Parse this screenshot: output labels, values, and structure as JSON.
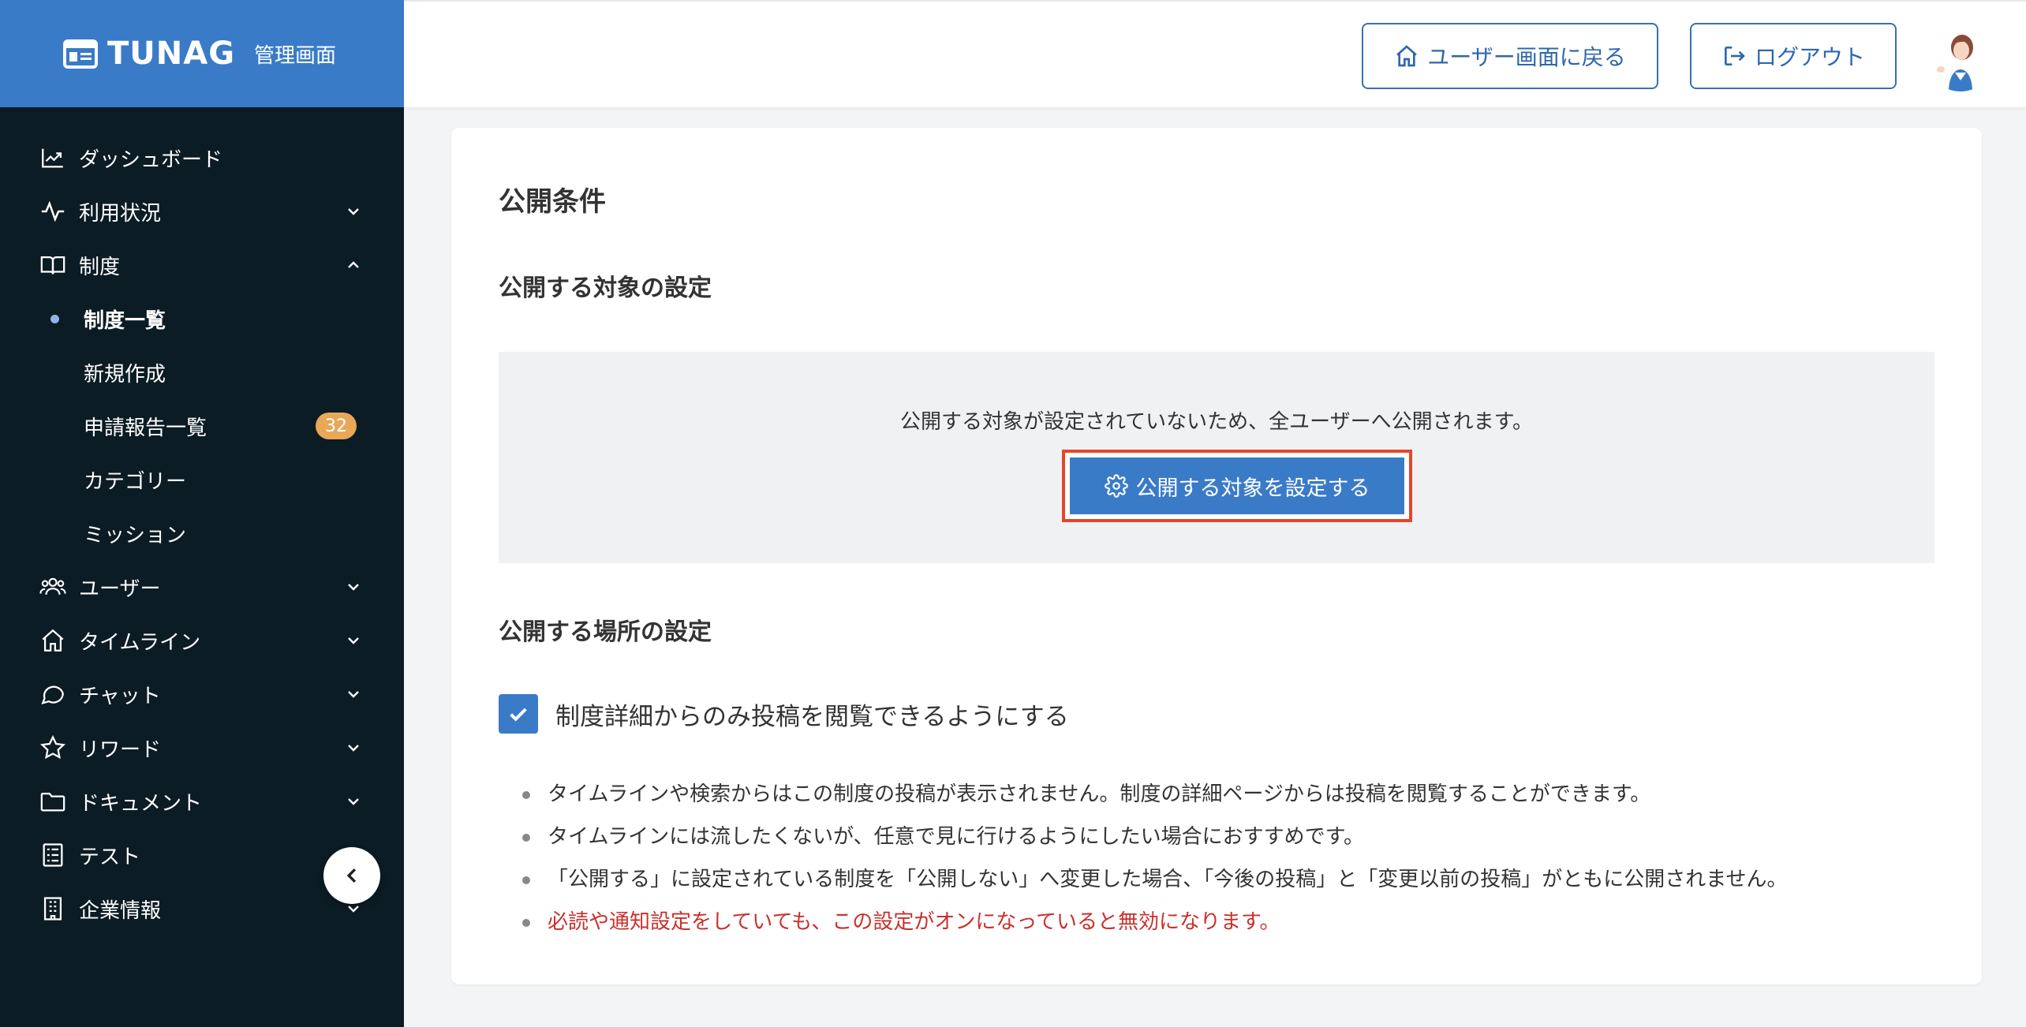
{
  "brand": {
    "name": "TUNAG",
    "sub": "管理画面",
    "color": "#3a7bc8"
  },
  "sidebar": {
    "items": [
      {
        "label": "ダッシュボード",
        "icon": "chart-line-icon"
      },
      {
        "label": "利用状況",
        "icon": "activity-icon",
        "chevron": "down"
      },
      {
        "label": "制度",
        "icon": "book-open-icon",
        "chevron": "up"
      },
      {
        "label": "ユーザー",
        "icon": "users-icon",
        "chevron": "down"
      },
      {
        "label": "タイムライン",
        "icon": "home-icon",
        "chevron": "down"
      },
      {
        "label": "チャット",
        "icon": "chat-bubble-icon",
        "chevron": "down"
      },
      {
        "label": "リワード",
        "icon": "star-icon",
        "chevron": "down"
      },
      {
        "label": "ドキュメント",
        "icon": "folder-icon",
        "chevron": "down"
      },
      {
        "label": "テスト",
        "icon": "checklist-icon",
        "chevron": "down"
      },
      {
        "label": "企業情報",
        "icon": "building-icon",
        "chevron": "down"
      }
    ],
    "sub_items": [
      {
        "label": "制度一覧",
        "active": true
      },
      {
        "label": "新規作成"
      },
      {
        "label": "申請報告一覧",
        "badge": "32"
      },
      {
        "label": "カテゴリー"
      },
      {
        "label": "ミッション"
      }
    ]
  },
  "header": {
    "back_label": "ユーザー画面に戻る",
    "logout_label": "ログアウト"
  },
  "main": {
    "title": "公開条件",
    "target_section": {
      "title": "公開する対象の設定",
      "note": "公開する対象が設定されていないため、全ユーザーへ公開されます。",
      "button_label": "公開する対象を設定する"
    },
    "place_section": {
      "title": "公開する場所の設定",
      "checkbox_label": "制度詳細からのみ投稿を閲覧できるようにする",
      "checked": true,
      "notes": [
        "タイムラインや検索からはこの制度の投稿が表示されません。制度の詳細ページからは投稿を閲覧することができます。",
        "タイムラインには流したくないが、任意で見に行けるようにしたい場合におすすめです。",
        "「公開する」に設定されている制度を「公開しない」へ変更した場合、「今後の投稿」と「変更以前の投稿」がともに公開されません。",
        "必読や通知設定をしていても、この設定がオンになっていると無効になります。"
      ]
    }
  },
  "colors": {
    "accent": "#3a7bc8",
    "highlight": "#e5462a",
    "warning": "#c9302c",
    "sidebar_bg": "#0c1c24",
    "badge": "#e8a858"
  }
}
